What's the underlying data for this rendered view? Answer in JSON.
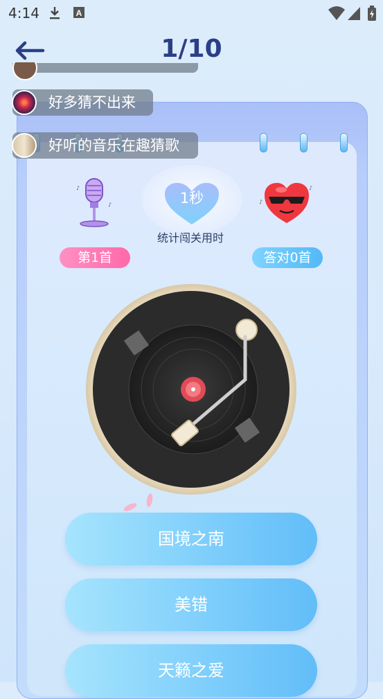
{
  "status_bar": {
    "time": "4:14",
    "icons": [
      "download-icon",
      "font-a-icon",
      "wifi-icon",
      "signal-icon",
      "battery-icon"
    ]
  },
  "header": {
    "back_icon": "back-arrow-icon",
    "title": "1/10"
  },
  "chat": {
    "messages": [
      {
        "text": ""
      },
      {
        "text": "好多猜不出来"
      },
      {
        "text": "好听的音乐在趣猜歌"
      }
    ]
  },
  "stats": {
    "timer_value": "1秒",
    "timer_caption": "统计闯关用时",
    "song_number": "第1首",
    "correct_count": "答对0首"
  },
  "options": [
    {
      "label": "国境之南"
    },
    {
      "label": "美错"
    },
    {
      "label": "天籁之爱"
    }
  ],
  "colors": {
    "title": "#2b3f86",
    "pill_pink": "#ff7fb6",
    "pill_blue": "#62c2f9",
    "option": "#7ccdfb"
  }
}
